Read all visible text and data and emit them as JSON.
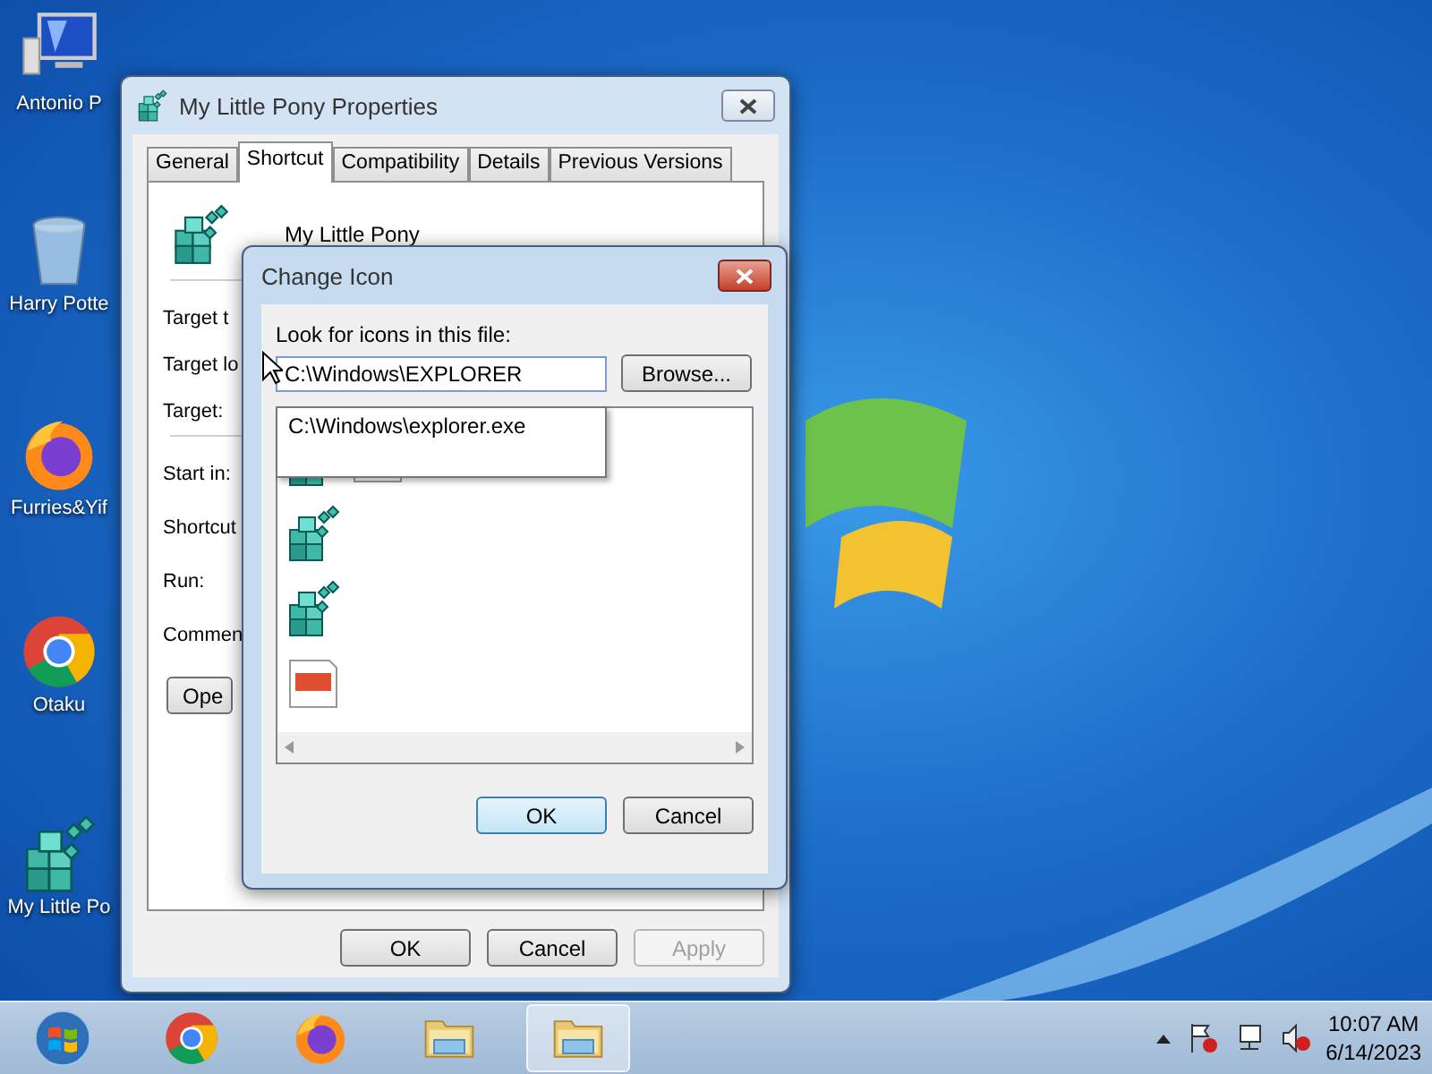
{
  "desktop_icons": [
    {
      "kind": "computer",
      "label": "Antonio P"
    },
    {
      "kind": "recycle",
      "label": "Harry Potte"
    },
    {
      "kind": "firefox",
      "label": "Furries&Yif"
    },
    {
      "kind": "chrome",
      "label": "Otaku"
    },
    {
      "kind": "cubes",
      "label": "My Little Po"
    }
  ],
  "properties_window": {
    "title": "My Little Pony Properties",
    "tabs": [
      {
        "label": "General",
        "selected": false
      },
      {
        "label": "Shortcut",
        "selected": true
      },
      {
        "label": "Compatibility",
        "selected": false
      },
      {
        "label": "Details",
        "selected": false
      },
      {
        "label": "Previous Versions",
        "selected": false
      }
    ],
    "shortcut_name": "My Little Pony",
    "fields": [
      {
        "label": "Target t"
      },
      {
        "label": "Target lo"
      },
      {
        "label": "Target:"
      },
      {
        "label": "Start in:"
      },
      {
        "label": "Shortcut"
      },
      {
        "label": "Run:"
      },
      {
        "label": "Commen"
      }
    ],
    "open_button": "Ope",
    "buttons": [
      {
        "label": "OK",
        "disabled": false
      },
      {
        "label": "Cancel",
        "disabled": false
      },
      {
        "label": "Apply",
        "disabled": true
      }
    ]
  },
  "change_icon_dialog": {
    "title": "Change Icon",
    "prompt": "Look for icons in this file:",
    "file_path": "C:\\Windows\\EXPLORER",
    "suggestion": "C:\\Windows\\explorer.exe",
    "browse_button": "Browse...",
    "buttons": [
      {
        "label": "OK",
        "default": true
      },
      {
        "label": "Cancel",
        "default": false
      }
    ]
  },
  "taskbar": {
    "items": [
      {
        "kind": "start",
        "active": false
      },
      {
        "kind": "chrome",
        "active": false
      },
      {
        "kind": "firefox",
        "active": false
      },
      {
        "kind": "folder",
        "active": false
      },
      {
        "kind": "folder",
        "active": true
      }
    ],
    "time": "10:07 AM",
    "date": "6/14/2023"
  }
}
